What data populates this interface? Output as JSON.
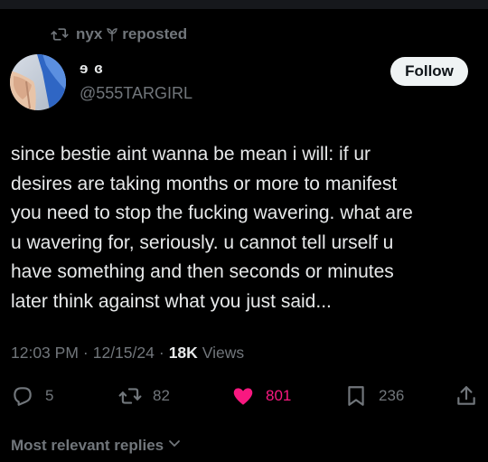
{
  "repost": {
    "user": "nyx",
    "suffix": "reposted"
  },
  "author": {
    "display_name": "ɘ ɞ",
    "handle": "@555TARGIRL",
    "follow_label": "Follow"
  },
  "tweet": {
    "text": "since bestie aint wanna be mean i will: if ur\ndesires are taking months or more to manifest\nyou need to stop the fucking wavering. what are\nu wavering for, seriously. u cannot tell urself u\nhave something and then seconds or minutes\nlater think against what you just said...",
    "time": "12:03 PM",
    "date": "12/15/24",
    "separator": "·",
    "views_count": "18K",
    "views_label": "Views"
  },
  "actions": {
    "replies": "5",
    "reposts": "82",
    "likes": "801",
    "bookmarks": "236"
  },
  "replies_sort": {
    "label": "Most relevant replies"
  },
  "colors": {
    "background": "#000000",
    "text": "#e7e9ea",
    "muted": "#71767b",
    "like": "#f91880",
    "follow_bg": "#eff3f4"
  }
}
